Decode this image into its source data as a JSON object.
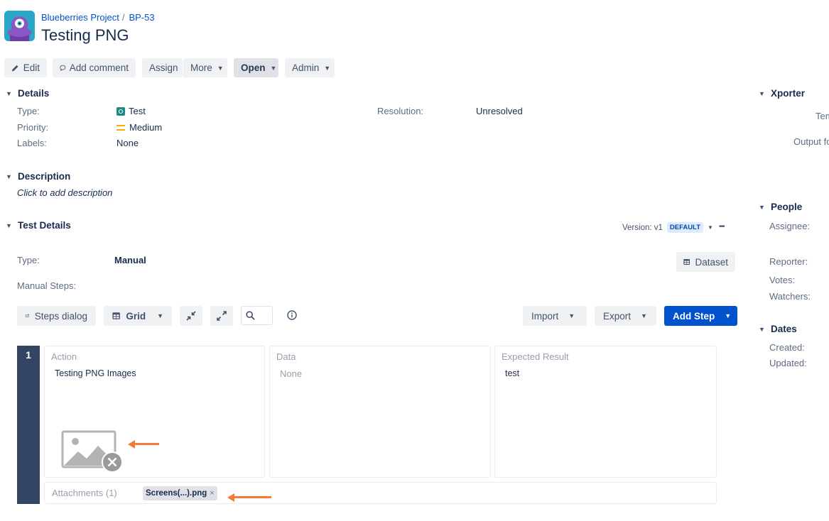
{
  "header": {
    "project": "Blueberries Project",
    "separator": "/",
    "issue_key": "BP-53",
    "title": "Testing PNG"
  },
  "toolbar": {
    "edit": "Edit",
    "add_comment": "Add comment",
    "assign": "Assign",
    "more": "More",
    "open": "Open",
    "admin": "Admin"
  },
  "details": {
    "heading": "Details",
    "type_label": "Type:",
    "type_value": "Test",
    "priority_label": "Priority:",
    "priority_value": "Medium",
    "labels_label": "Labels:",
    "labels_value": "None",
    "resolution_label": "Resolution:",
    "resolution_value": "Unresolved"
  },
  "description": {
    "heading": "Description",
    "placeholder": "Click to add description"
  },
  "test_details": {
    "heading": "Test Details",
    "version_label": "Version: v1",
    "version_badge": "DEFAULT",
    "more_glyph": "•••",
    "type_label": "Type:",
    "type_value": "Manual",
    "dataset_button": "Dataset",
    "manual_steps_label": "Manual Steps:",
    "steps_dialog": "Steps dialog",
    "grid": "Grid",
    "import": "Import",
    "export": "Export",
    "add_step": "Add Step"
  },
  "steps": [
    {
      "number": "1",
      "action_header": "Action",
      "action": "Testing PNG Images",
      "data_header": "Data",
      "data": "None",
      "expected_header": "Expected Result",
      "expected": "test",
      "attachments_label": "Attachments (1)",
      "attachment_name": "Screens(...).png",
      "attachment_remove": "×"
    }
  ],
  "right_panel": {
    "xporter": "Xporter",
    "template_partial": "Tem",
    "output_partial": "Output fo",
    "people": "People",
    "assignee_label": "Assignee:",
    "reporter_label": "Reporter:",
    "votes_label": "Votes:",
    "watchers_label": "Watchers:",
    "dates": "Dates",
    "created_label": "Created:",
    "updated_label": "Updated:"
  },
  "colors": {
    "link": "#0052cc",
    "primary_button": "#0052cc",
    "step_bar": "#344563",
    "annotation_arrow": "#f47a39",
    "test_type_icon": "#1e8c84",
    "priority_medium": "#ffab00"
  }
}
